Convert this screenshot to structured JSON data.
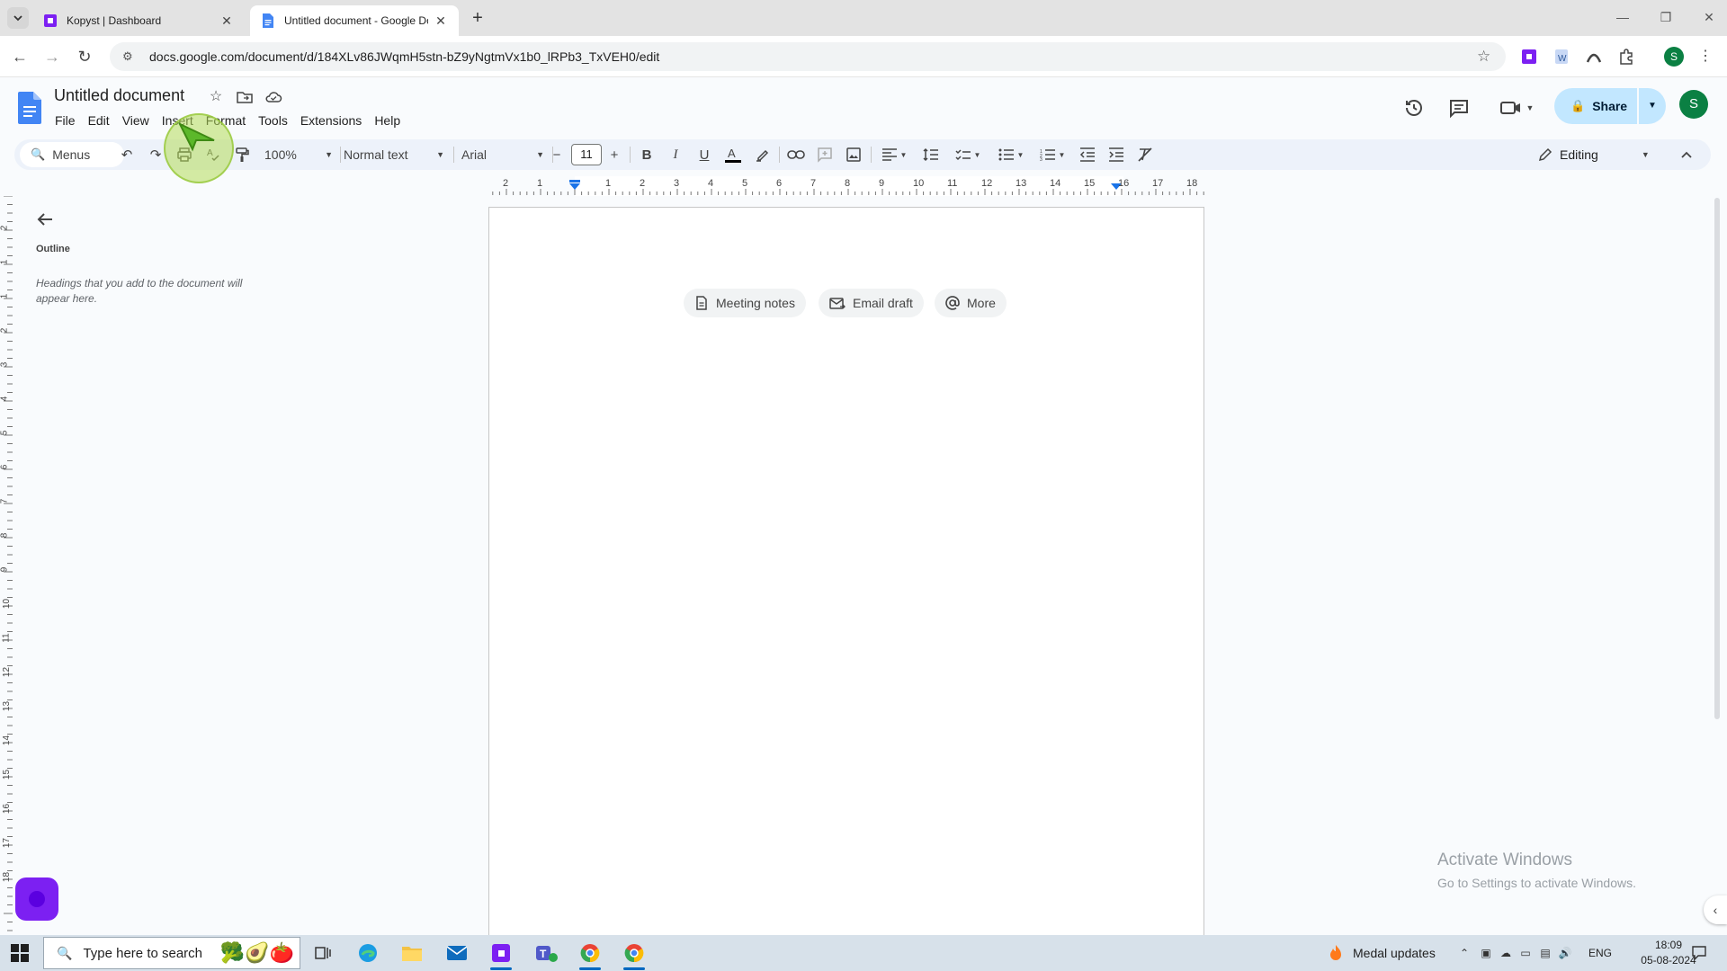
{
  "browser": {
    "tabs": [
      {
        "title": "Kopyst | Dashboard",
        "active": false
      },
      {
        "title": "Untitled document - Google Do",
        "active": true
      }
    ],
    "url": "docs.google.com/document/d/184XLv86JWqmH5stn-bZ9yNgtmVx1b0_lRPb3_TxVEH0/edit",
    "profile_initial": "S"
  },
  "docs": {
    "title": "Untitled document",
    "menus": [
      "File",
      "Edit",
      "View",
      "Insert",
      "Format",
      "Tools",
      "Extensions",
      "Help"
    ],
    "share_label": "Share",
    "account_initial": "S"
  },
  "toolbar": {
    "search_label": "Menus",
    "zoom": "100%",
    "style": "Normal text",
    "font": "Arial",
    "font_size": "11",
    "mode": "Editing"
  },
  "ruler": {
    "horizontal": [
      "2",
      "1",
      "1",
      "2",
      "3",
      "4",
      "5",
      "6",
      "7",
      "8",
      "9",
      "10",
      "11",
      "12",
      "13",
      "14",
      "15",
      "16",
      "17",
      "18"
    ],
    "vertical": [
      "2",
      "1",
      "1",
      "2",
      "3",
      "4",
      "5",
      "6",
      "7",
      "8",
      "9",
      "10",
      "11",
      "12",
      "13",
      "14",
      "15",
      "16",
      "17",
      "18"
    ]
  },
  "outline": {
    "title": "Outline",
    "hint": "Headings that you add to the document will appear here."
  },
  "chips": [
    {
      "label": "Meeting notes",
      "icon": "document-icon"
    },
    {
      "label": "Email draft",
      "icon": "email-icon"
    },
    {
      "label": "More",
      "icon": "at-sign-icon"
    }
  ],
  "watermark": {
    "line1": "Activate Windows",
    "line2": "Go to Settings to activate Windows."
  },
  "taskbar": {
    "search_placeholder": "Type here to search",
    "notification": "Medal updates",
    "language": "ENG",
    "time": "18:09",
    "date": "05-08-2024"
  },
  "colors": {
    "docs_blue": "#4285f4",
    "share_bg": "#c2e7ff",
    "avatar_green": "#0b8043",
    "kopyst_purple": "#7c20f2"
  }
}
